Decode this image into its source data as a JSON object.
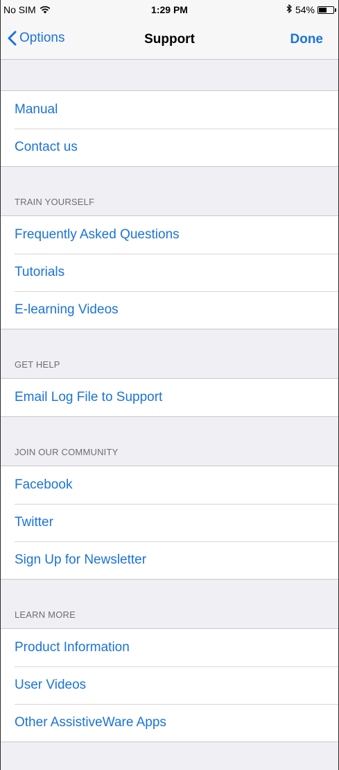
{
  "status_bar": {
    "carrier": "No SIM",
    "time": "1:29 PM",
    "battery_text": "54%",
    "battery_level": 0.54
  },
  "nav": {
    "back_label": "Options",
    "title": "Support",
    "done_label": "Done"
  },
  "top_group": {
    "items": [
      "Manual",
      "Contact us"
    ]
  },
  "sections": [
    {
      "header": "TRAIN YOURSELF",
      "items": [
        "Frequently Asked Questions",
        "Tutorials",
        "E-learning Videos"
      ]
    },
    {
      "header": "GET HELP",
      "items": [
        "Email Log File to Support"
      ]
    },
    {
      "header": "JOIN OUR COMMUNITY",
      "items": [
        "Facebook",
        "Twitter",
        "Sign Up for Newsletter"
      ]
    },
    {
      "header": "LEARN MORE",
      "items": [
        "Product Information",
        "User Videos",
        "Other AssistiveWare Apps"
      ]
    }
  ],
  "colors": {
    "accent": "#1a73d9",
    "background": "#efeff4",
    "section_header": "#6d6d72"
  },
  "icons": {
    "wifi": "wifi-icon",
    "bluetooth": "bluetooth-icon",
    "battery": "battery-icon",
    "back": "chevron-left-icon"
  }
}
